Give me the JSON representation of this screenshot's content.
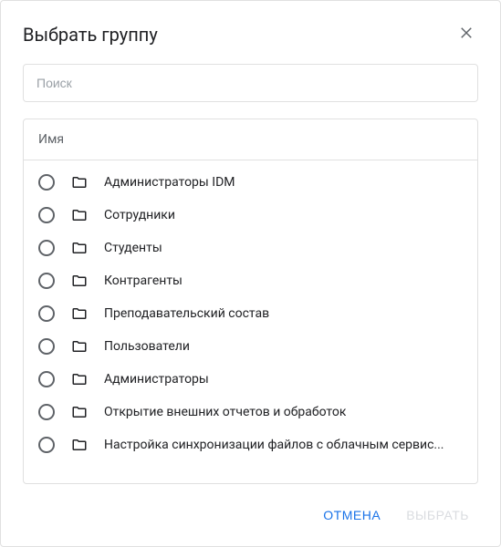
{
  "dialog": {
    "title": "Выбрать группу"
  },
  "search": {
    "placeholder": "Поиск",
    "value": ""
  },
  "list": {
    "header": "Имя",
    "items": [
      {
        "label": "Администраторы IDM"
      },
      {
        "label": "Сотрудники"
      },
      {
        "label": "Студенты"
      },
      {
        "label": "Контрагенты"
      },
      {
        "label": "Преподавательский состав"
      },
      {
        "label": "Пользователи"
      },
      {
        "label": "Администраторы"
      },
      {
        "label": "Открытие внешних отчетов и обработок"
      },
      {
        "label": "Настройка синхронизации файлов с облачным сервис..."
      }
    ]
  },
  "footer": {
    "cancel": "ОТМЕНА",
    "select": "ВЫБРАТЬ"
  }
}
